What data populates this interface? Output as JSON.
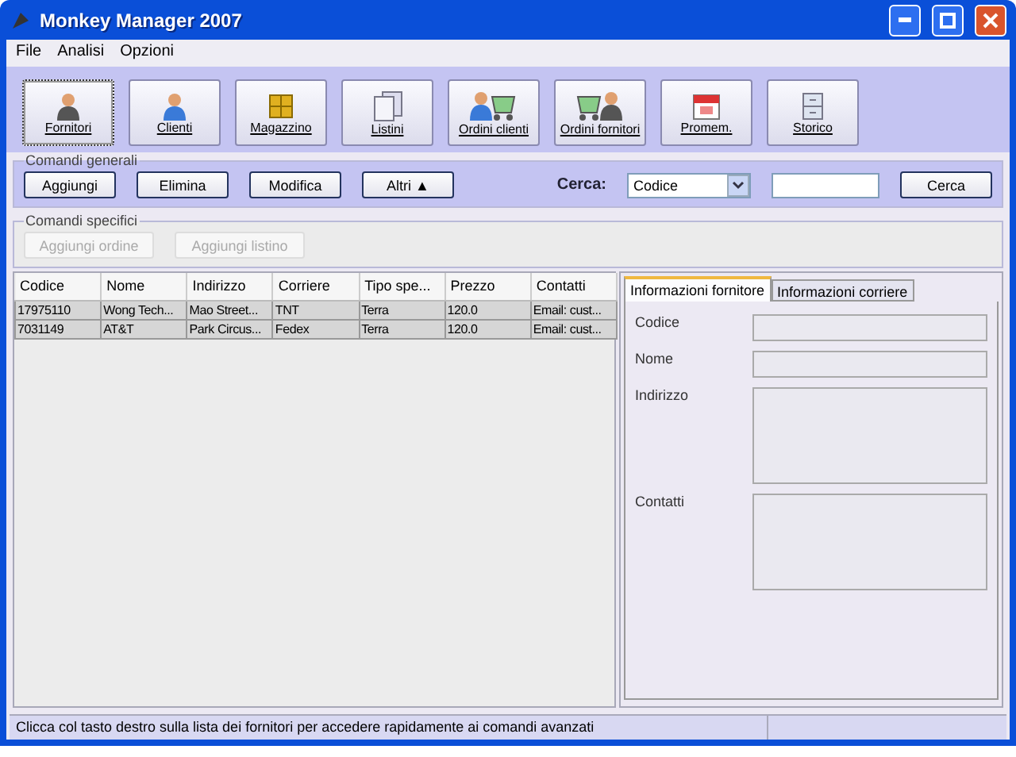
{
  "window": {
    "title": "Monkey Manager 2007"
  },
  "menu": [
    "File",
    "Analisi",
    "Opzioni"
  ],
  "toolbar": [
    {
      "label": "Fornitori",
      "selected": true
    },
    {
      "label": "Clienti",
      "selected": false
    },
    {
      "label": "Magazzino",
      "selected": false
    },
    {
      "label": "Listini",
      "selected": false
    },
    {
      "label": "Ordini clienti",
      "selected": false
    },
    {
      "label": "Ordini fornitori",
      "selected": false
    },
    {
      "label": "Promem.",
      "selected": false
    },
    {
      "label": "Storico",
      "selected": false
    }
  ],
  "general_commands": {
    "title": "Comandi generali",
    "buttons": [
      "Aggiungi",
      "Elimina",
      "Modifica",
      "Altri ▲"
    ],
    "search_label": "Cerca:",
    "search_field": "Codice",
    "search_button": "Cerca"
  },
  "specific_commands": {
    "title": "Comandi specifici",
    "buttons": [
      {
        "label": "Aggiungi ordine",
        "disabled": true
      },
      {
        "label": "Aggiungi listino",
        "disabled": true
      }
    ]
  },
  "table": {
    "columns": [
      "Codice",
      "Nome",
      "Indirizzo",
      "Corriere",
      "Tipo spe...",
      "Prezzo",
      "Contatti"
    ],
    "rows": [
      [
        "17975110",
        "Wong Tech...",
        "Mao Street...",
        "TNT",
        "Terra",
        "120.0",
        "Email: cust..."
      ],
      [
        "7031149",
        "AT&T",
        "Park Circus...",
        "Fedex",
        "Terra",
        "120.0",
        "Email: cust..."
      ]
    ]
  },
  "details": {
    "tabs": [
      {
        "label": "Informazioni fornitore",
        "selected": true
      },
      {
        "label": "Informazioni corriere",
        "selected": false
      }
    ],
    "fields": [
      {
        "label": "Codice",
        "kind": "line"
      },
      {
        "label": "Nome",
        "kind": "line"
      },
      {
        "label": "Indirizzo",
        "kind": "area"
      },
      {
        "label": "Contatti",
        "kind": "area"
      }
    ]
  },
  "status_bar": "Clicca col tasto destro sulla lista dei fornitori per accedere rapidamente ai comandi avanzati"
}
